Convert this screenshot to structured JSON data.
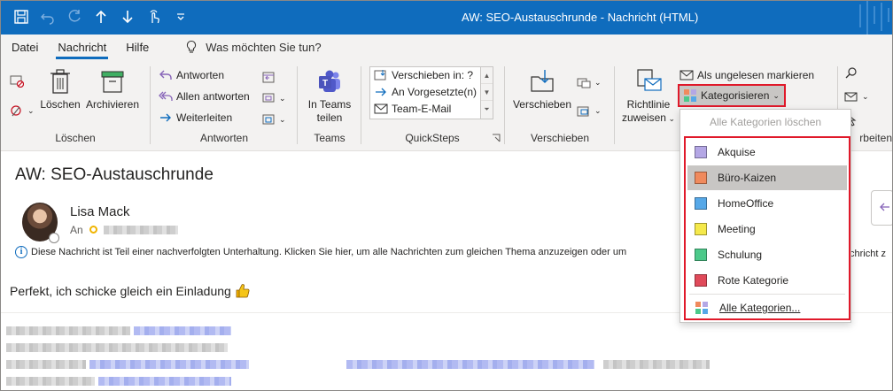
{
  "window": {
    "title": "AW: SEO-Austauschrunde  -  Nachricht (HTML)",
    "accent": "#0f6cbd"
  },
  "tabs": [
    {
      "label": "Datei"
    },
    {
      "label": "Nachricht",
      "active": true
    },
    {
      "label": "Hilfe"
    }
  ],
  "tell_me": "Was möchten Sie tun?",
  "ribbon": {
    "loeschen": {
      "label": "Löschen",
      "delete": "Löschen",
      "archive": "Archivieren"
    },
    "antworten": {
      "label": "Antworten",
      "reply": "Antworten",
      "reply_all": "Allen antworten",
      "forward": "Weiterleiten"
    },
    "teams": {
      "label": "Teams",
      "share_line1": "In Teams",
      "share_line2": "teilen"
    },
    "quicksteps": {
      "label": "QuickSteps",
      "items": [
        "Verschieben in: ?",
        "An Vorgesetzte(n)",
        "Team-E-Mail"
      ]
    },
    "verschieben": {
      "label": "Verschieben",
      "move": "Verschieben"
    },
    "kategorien": {
      "rules_line1": "Richtlinie",
      "rules_line2": "zuweisen",
      "unread": "Als ungelesen markieren",
      "categorize": "Kategorisieren",
      "editing_partial": "rbeiten"
    }
  },
  "category_menu": {
    "clear_all": "Alle Kategorien löschen",
    "items": [
      {
        "label": "Akquise",
        "color": "#b4a7e5"
      },
      {
        "label": "Büro-Kaizen",
        "color": "#f08a5d",
        "highlighted": true
      },
      {
        "label": "HomeOffice",
        "color": "#56a8e8"
      },
      {
        "label": "Meeting",
        "color": "#f5e94b"
      },
      {
        "label": "Schulung",
        "color": "#4cc98a"
      },
      {
        "label": "Rote Kategorie",
        "color": "#e04a5a"
      }
    ],
    "all_categories": "Alle Kategorien..."
  },
  "message": {
    "subject": "AW: SEO-Austauschrunde",
    "sender": "Lisa Mack",
    "to_label": "An",
    "info": "Diese Nachricht ist Teil einer nachverfolgten Unterhaltung. Klicken Sie hier, um alle Nachrichten zum gleichen Thema anzuzeigen oder um",
    "info_tail": "chricht z",
    "body": "Perfekt, ich schicke gleich ein Einladung"
  }
}
